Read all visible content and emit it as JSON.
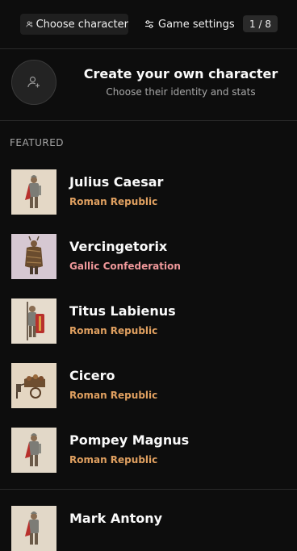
{
  "header": {
    "choose_tab": "Choose character",
    "settings_tab": "Game settings",
    "counter": "1 / 8",
    "icons": {
      "choose": "user-icon",
      "settings": "sliders-icon"
    }
  },
  "create": {
    "title": "Create your own character",
    "subtitle": "Choose their identity and stats",
    "icon": "add-user-icon"
  },
  "featured": {
    "label": "FEATURED",
    "characters": [
      {
        "name": "Julius Caesar",
        "faction": "Roman Republic",
        "faction_color": "#e0a060",
        "thumb_bg": "#e4d8c6"
      },
      {
        "name": "Vercingetorix",
        "faction": "Gallic Confederation",
        "faction_color": "#f0989a",
        "thumb_bg": "#d6c8d2"
      },
      {
        "name": "Titus Labienus",
        "faction": "Roman Republic",
        "faction_color": "#e0a060",
        "thumb_bg": "#e6dccd"
      },
      {
        "name": "Cicero",
        "faction": "Roman Republic",
        "faction_color": "#e0a060",
        "thumb_bg": "#e4d6c2"
      },
      {
        "name": "Pompey Magnus",
        "faction": "Roman Republic",
        "faction_color": "#e0a060",
        "thumb_bg": "#e2d8c8"
      },
      {
        "name": "Mark Antony",
        "faction": "",
        "faction_color": "#e0a060",
        "thumb_bg": "#e2d8c8"
      }
    ]
  }
}
